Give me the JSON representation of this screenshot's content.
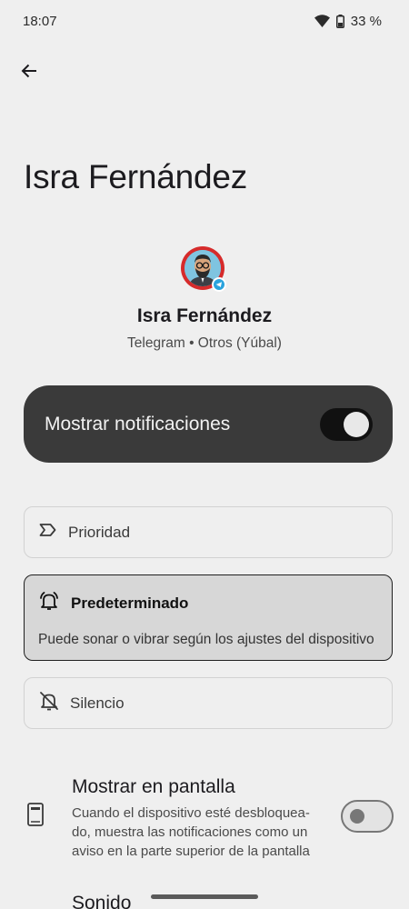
{
  "status_bar": {
    "time": "18:07",
    "battery": "33 %"
  },
  "page": {
    "title": "Isra Fernández"
  },
  "contact": {
    "name": "Isra Fernández",
    "subtitle": "Telegram • Otros (Yúbal)"
  },
  "master_toggle": {
    "label": "Mostrar notificaciones",
    "enabled": true
  },
  "options": {
    "prioridad": {
      "label": "Prioridad"
    },
    "predeterminado": {
      "label": "Predeterminado",
      "description": "Puede sonar o vibrar según los ajustes del dispositivo",
      "selected": true
    },
    "silencio": {
      "label": "Silencio"
    }
  },
  "pantalla": {
    "title": "Mostrar en pantalla",
    "description": "Cuando el dispositivo esté desbloquea-do, muestra las notificaciones como un aviso en la parte superior de la pantalla",
    "enabled": false
  },
  "sonido": {
    "title": "Sonido"
  },
  "colors": {
    "background": "#efefef",
    "toggle_card": "#3a3a3a",
    "selected_option": "#d7d7d7",
    "avatar_ring": "#d62b2b"
  },
  "icons": {
    "back": "arrow-back-icon",
    "wifi": "wifi-icon",
    "battery": "battery-icon",
    "prioridad": "priority-label-icon",
    "predeterminado": "bell-ring-icon",
    "silencio": "bell-off-icon",
    "pantalla": "phone-screen-icon",
    "app_badge": "telegram-icon",
    "sonido": "sound-icon"
  }
}
